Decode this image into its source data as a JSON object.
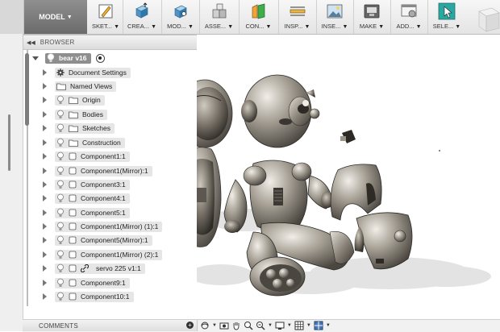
{
  "toolbar": {
    "workspace": {
      "label": "MODEL",
      "icon": "chevron-down-icon"
    },
    "groups": [
      {
        "label": "SKET...",
        "icon": "sketch-icon"
      },
      {
        "label": "CREA...",
        "icon": "extrude-icon"
      },
      {
        "label": "MOD...",
        "icon": "modify-icon"
      },
      {
        "label": "ASSE...",
        "icon": "assemble-icon"
      },
      {
        "label": "CON...",
        "icon": "construct-icon"
      },
      {
        "label": "INSP...",
        "icon": "inspect-icon"
      },
      {
        "label": "INSE...",
        "icon": "insert-icon"
      },
      {
        "label": "MAKE",
        "icon": "make-icon"
      },
      {
        "label": "ADD...",
        "icon": "addins-icon"
      },
      {
        "label": "SELE...",
        "icon": "select-icon"
      }
    ]
  },
  "browser": {
    "title": "BROWSER",
    "root": {
      "label": "bear v16"
    },
    "items": [
      {
        "label": "Document Settings",
        "kind": "settings"
      },
      {
        "label": "Named Views",
        "kind": "folder"
      },
      {
        "label": "Origin",
        "kind": "folder-bulb"
      },
      {
        "label": "Bodies",
        "kind": "folder-bulb"
      },
      {
        "label": "Sketches",
        "kind": "folder-bulb"
      },
      {
        "label": "Construction",
        "kind": "folder-bulb"
      },
      {
        "label": "Component1:1",
        "kind": "component"
      },
      {
        "label": "Component1(Mirror):1",
        "kind": "component"
      },
      {
        "label": "Component3:1",
        "kind": "component"
      },
      {
        "label": "Component4:1",
        "kind": "component"
      },
      {
        "label": "Component5:1",
        "kind": "component"
      },
      {
        "label": "Component1(Mirror) (1):1",
        "kind": "component"
      },
      {
        "label": "Component5(Mirror):1",
        "kind": "component"
      },
      {
        "label": "Component1(Mirror) (2):1",
        "kind": "component"
      },
      {
        "label": "servo 225 v1:1",
        "kind": "linked"
      },
      {
        "label": "Component9:1",
        "kind": "component"
      },
      {
        "label": "Component10:1",
        "kind": "component"
      }
    ]
  },
  "comments": {
    "label": "COMMENTS"
  },
  "colors": {
    "model_bg": "#7a7a7a",
    "select_accent": "#2aa7a0",
    "part_metal": "#8f8a80"
  }
}
